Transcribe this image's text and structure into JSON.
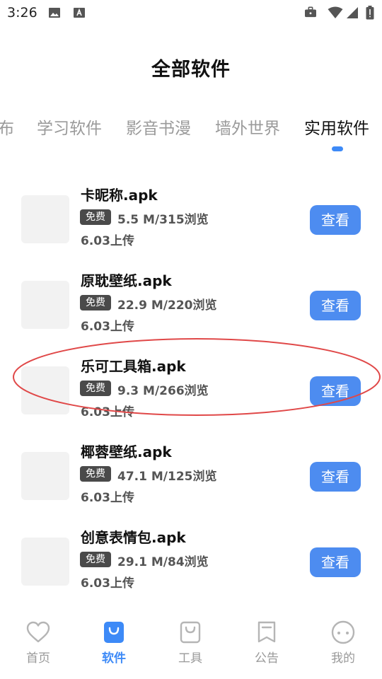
{
  "status_bar": {
    "time": "3:26"
  },
  "header": {
    "title": "全部软件"
  },
  "tabs": [
    {
      "label": "布"
    },
    {
      "label": "学习软件"
    },
    {
      "label": "影音书漫"
    },
    {
      "label": "墙外世界"
    },
    {
      "label": "实用软件",
      "active": true
    }
  ],
  "items": [
    {
      "name": "卡昵称.apk",
      "badge": "免费",
      "meta": "5.5 M/315浏览",
      "date": "6.03上传",
      "button": "查看"
    },
    {
      "name": "原耽壁纸.apk",
      "badge": "免费",
      "meta": "22.9 M/220浏览",
      "date": "6.03上传",
      "button": "查看"
    },
    {
      "name": "乐可工具箱.apk",
      "badge": "免费",
      "meta": "9.3 M/266浏览",
      "date": "6.03上传",
      "button": "查看"
    },
    {
      "name": "椰蓉壁纸.apk",
      "badge": "免费",
      "meta": "47.1 M/125浏览",
      "date": "6.03上传",
      "button": "查看"
    },
    {
      "name": "创意表情包.apk",
      "badge": "免费",
      "meta": "29.1 M/84浏览",
      "date": "6.03上传",
      "button": "查看"
    }
  ],
  "bottom_nav": [
    {
      "label": "首页",
      "icon": "heart-icon"
    },
    {
      "label": "软件",
      "icon": "shopping-bag-icon",
      "active": true
    },
    {
      "label": "工具",
      "icon": "bag-outline-icon"
    },
    {
      "label": "公告",
      "icon": "bookmark-icon"
    },
    {
      "label": "我的",
      "icon": "smiley-icon"
    }
  ],
  "colors": {
    "accent": "#3d8af7",
    "button": "#4d8cf0",
    "badge": "#4a4a4a",
    "highlight": "#e04848"
  }
}
